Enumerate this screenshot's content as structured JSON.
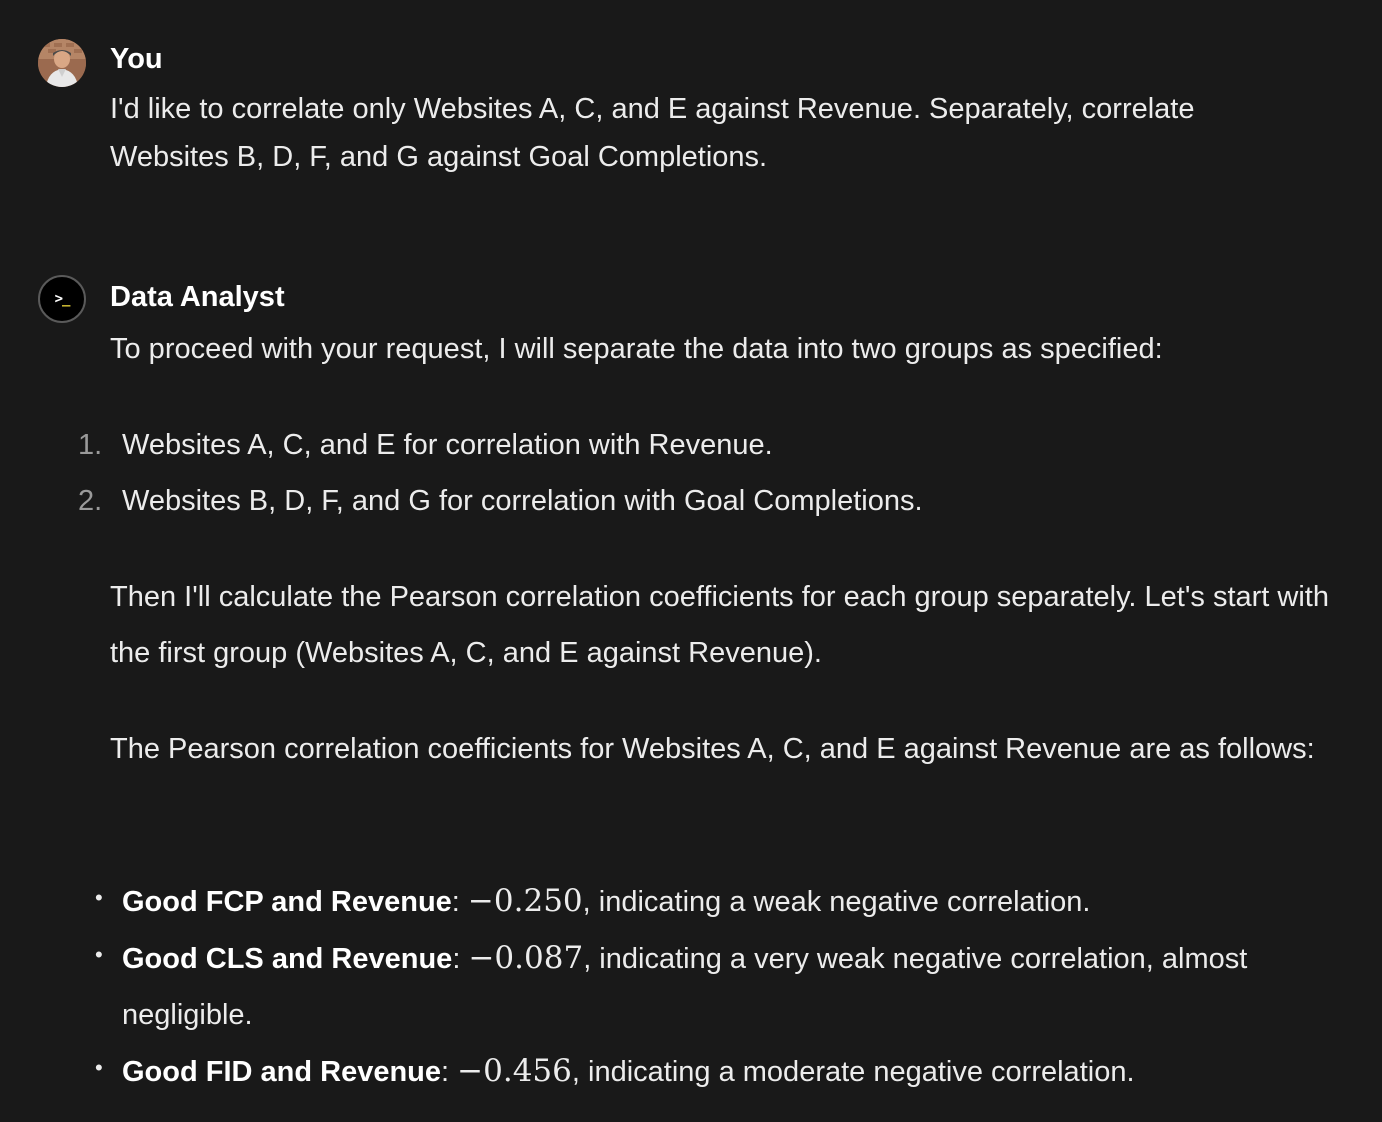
{
  "user_message": {
    "author": "You",
    "avatar_icon": "user-photo-avatar",
    "text": "I'd like to correlate only Websites A, C, and E against Revenue. Separately, correlate Websites B, D, F, and G against Goal Completions."
  },
  "assistant_message": {
    "author": "Data Analyst",
    "avatar_icon": "terminal-prompt-icon",
    "avatar_glyph": ">",
    "avatar_glyph_cursor": "_",
    "intro": "To proceed with your request, I will separate the data into two groups as specified:",
    "ordered_list": [
      {
        "number": "1.",
        "text": "Websites A, C, and E for correlation with Revenue."
      },
      {
        "number": "2.",
        "text": "Websites B, D, F, and G for correlation with Goal Completions."
      }
    ],
    "paragraph_2": "Then I'll calculate the Pearson correlation coefficients for each group separately. Let's start with the first group (Websites A, C, and E against Revenue).",
    "paragraph_3": "The Pearson correlation coefficients for Websites A, C, and E against Revenue are as follows:",
    "bullets": [
      {
        "label": "Good FCP and Revenue",
        "separator": ":",
        "value": "−0.250",
        "text": ", indicating a weak negative correlation."
      },
      {
        "label": "Good CLS and Revenue",
        "separator": ":",
        "value": "−0.087",
        "text": ", indicating a very weak negative correlation, almost negligible."
      },
      {
        "label": "Good FID and Revenue",
        "separator": ":",
        "value": "−0.456",
        "text": ", indicating a moderate negative correlation."
      }
    ],
    "bullet_marker": "•"
  },
  "colors": {
    "background": "#191919",
    "text": "#ececec",
    "author": "#ffffff",
    "list_number": "#9a9a9a",
    "bot_avatar_bg": "#000000",
    "bot_cursor": "#e8d33a"
  }
}
